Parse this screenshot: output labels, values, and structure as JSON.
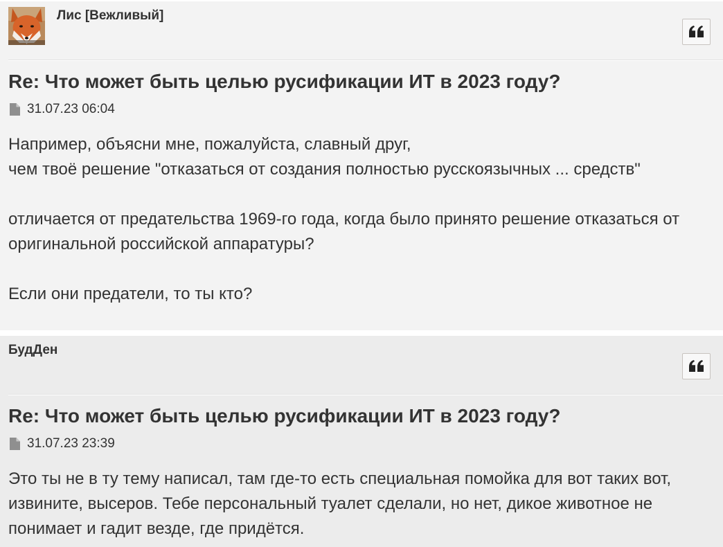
{
  "posts": [
    {
      "author": "Лис [Вежливый]",
      "has_avatar": true,
      "title": "Re: Что может быть целью русификации ИТ в 2023 году?",
      "date": "31.07.23 06:04",
      "lines": [
        "Например, объясни мне, пожалуйста, славный друг,",
        "чем твоё решение \"отказаться от создания полностью русскоязычных ... средств\"",
        "",
        "отличается от предательства 1969-го года, когда было принято решение отказаться от",
        "оригинальной российской аппаратуры?",
        "",
        "Если они предатели, то ты кто?"
      ]
    },
    {
      "author": "БудДен",
      "has_avatar": false,
      "title": "Re: Что может быть целью русификации ИТ в 2023 году?",
      "date": "31.07.23 23:39",
      "lines": [
        "Это ты не в ту тему написал, там где-то есть специальная помойка для вот таких вот,",
        "извините, высеров. Тебе персональный туалет сделали, но нет, дикое животное не",
        "понимает и гадит везде, где придётся."
      ]
    }
  ],
  "icons": {
    "quote": "quote-icon",
    "file": "file-icon",
    "avatar": "fox-avatar"
  },
  "colors": {
    "post1_bg": "#f3f3f3",
    "post2_bg": "#ececec",
    "text": "#333333",
    "icon": "#8f8f8f"
  }
}
